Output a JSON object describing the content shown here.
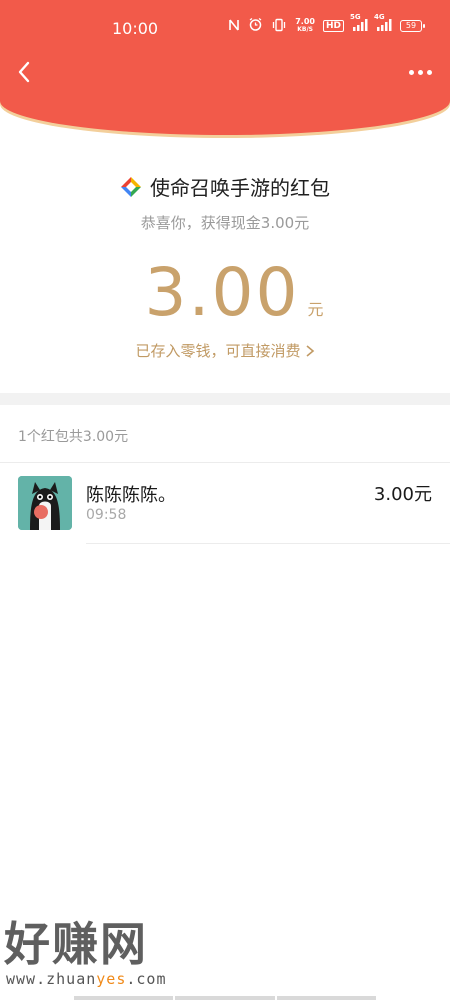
{
  "status_bar": {
    "time": "10:00",
    "speed_value": "7.00",
    "speed_unit": "KB/S",
    "hd_badge": "HD",
    "network_5g": "5G",
    "network_4g": "4G",
    "battery": "59"
  },
  "header": {
    "back_icon": "chevron-left-icon",
    "more_icon": "more-dots-icon",
    "color": "#f25a4a",
    "accent": "#f3cf9b"
  },
  "packet": {
    "sender_title": "使命召唤手游的红包",
    "congrats": "恭喜你，获得现金3.00元",
    "amount": "3.00",
    "amount_unit": "元",
    "saved_text": "已存入零钱，可直接消费",
    "amount_color": "#c9a26c"
  },
  "list": {
    "summary": "1个红包共3.00元",
    "entries": [
      {
        "name": "陈陈陈陈。",
        "time": "09:58",
        "amount": "3.00元"
      }
    ]
  },
  "watermark": {
    "main": "好赚网",
    "url_prefix": "www.zhuan",
    "url_highlight": "yes",
    "url_suffix": ".com"
  }
}
